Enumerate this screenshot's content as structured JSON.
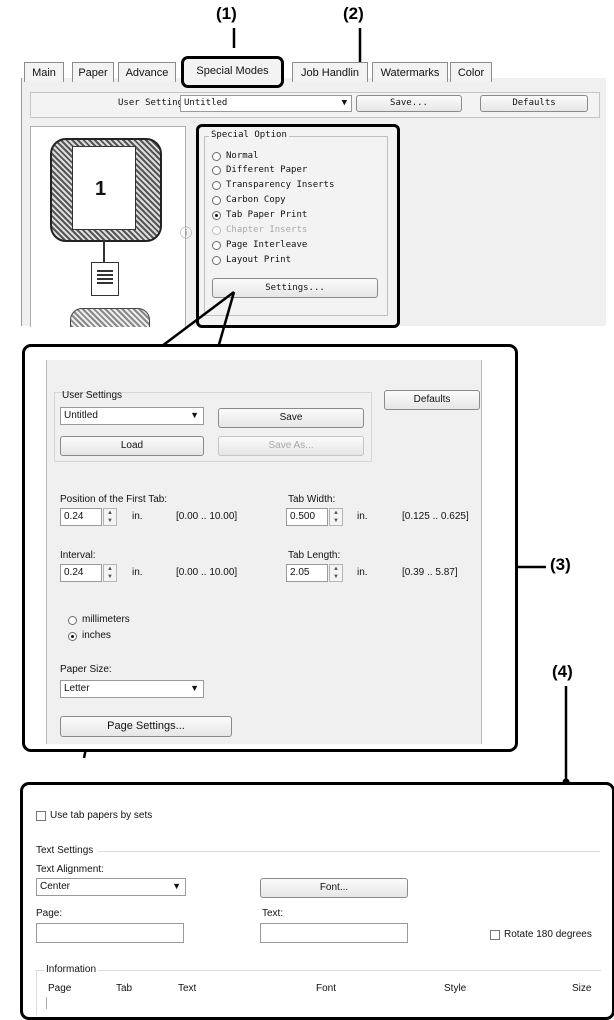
{
  "callouts": {
    "c1": "(1)",
    "c2": "(2)",
    "c3": "(3)",
    "c4": "(4)"
  },
  "top_dialog": {
    "tabs": [
      "Main",
      "Paper",
      "Advance",
      "Special Modes",
      "Job Handlin",
      "Watermarks",
      "Color"
    ],
    "user_settings_label": "User Settings:",
    "user_settings_value": "Untitled",
    "save_label": "Save...",
    "defaults_label": "Defaults",
    "preview_page_number": "1",
    "special_option_title": "Special Option",
    "options": [
      "Normal",
      "Different Paper",
      "Transparency Inserts",
      "Carbon Copy",
      "Tab Paper Print",
      "Chapter Inserts",
      "Page Interleave",
      "Layout Print"
    ],
    "settings_label": "Settings..."
  },
  "tab_dialog": {
    "user_settings_title": "User Settings",
    "user_settings_value": "Untitled",
    "save_label": "Save",
    "load_label": "Load",
    "save_as_label": "Save As...",
    "defaults_label": "Defaults",
    "first_tab_label": "Position of the First Tab:",
    "first_tab_value": "0.24",
    "first_tab_unit": "in.",
    "first_tab_range": "[0.00 .. 10.00]",
    "tab_width_label": "Tab Width:",
    "tab_width_value": "0.500",
    "tab_width_unit": "in.",
    "tab_width_range": "[0.125 .. 0.625]",
    "interval_label": "Interval:",
    "interval_value": "0.24",
    "interval_unit": "in.",
    "interval_range": "[0.00 .. 10.00]",
    "tab_length_label": "Tab Length:",
    "tab_length_value": "2.05",
    "tab_length_unit": "in.",
    "tab_length_range": "[0.39 .. 5.87]",
    "unit_mm": "millimeters",
    "unit_in": "inches",
    "paper_size_label": "Paper Size:",
    "paper_size_value": "Letter",
    "page_settings_label": "Page Settings..."
  },
  "page_dialog": {
    "use_sets_label": "Use tab papers by sets",
    "text_settings_title": "Text Settings",
    "alignment_label": "Text Alignment:",
    "alignment_value": "Center",
    "font_label": "Font...",
    "page_label": "Page:",
    "text_label": "Text:",
    "rotate_label": "Rotate 180 degrees",
    "information_title": "Information",
    "columns": [
      "Page",
      "Tab",
      "Text",
      "Font",
      "Style",
      "Size"
    ]
  }
}
